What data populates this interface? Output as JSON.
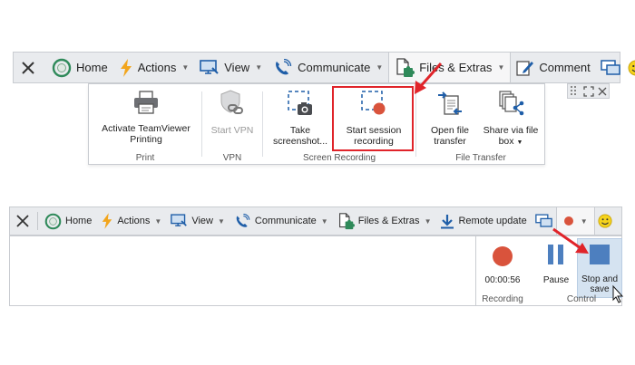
{
  "toolbar1": {
    "home": "Home",
    "actions": "Actions",
    "view": "View",
    "communicate": "Communicate",
    "files_extras": "Files & Extras",
    "comment": "Comment"
  },
  "ribbon1": {
    "print_group": {
      "label": "Print",
      "button_line1": "Activate TeamViewer",
      "button_line2": "Printing"
    },
    "vpn_group": {
      "label": "VPN",
      "button": "Start VPN"
    },
    "screen_recording_group": {
      "label": "Screen Recording",
      "screenshot_line1": "Take",
      "screenshot_line2": "screenshot...",
      "start_session_line1": "Start session",
      "start_session_line2": "recording"
    },
    "file_transfer_group": {
      "label": "File Transfer",
      "open_line1": "Open file",
      "open_line2": "transfer",
      "share_line1": "Share via file",
      "share_line2": "box"
    }
  },
  "toolbar2": {
    "home": "Home",
    "actions": "Actions",
    "view": "View",
    "communicate": "Communicate",
    "files_extras": "Files & Extras",
    "remote_update": "Remote update"
  },
  "ribbon2": {
    "recording_group": {
      "label": "Recording",
      "timer": "00:00:56"
    },
    "control_group": {
      "label": "Control",
      "pause": "Pause",
      "stop_line1": "Stop and",
      "stop_line2": "save"
    }
  },
  "colors": {
    "highlight_red": "#e0242a",
    "record_red": "#d9533c",
    "pause_blue": "#4d7fbf",
    "toolbar_bg": "#e9ebee",
    "selected_bg": "#d5e3f1"
  }
}
